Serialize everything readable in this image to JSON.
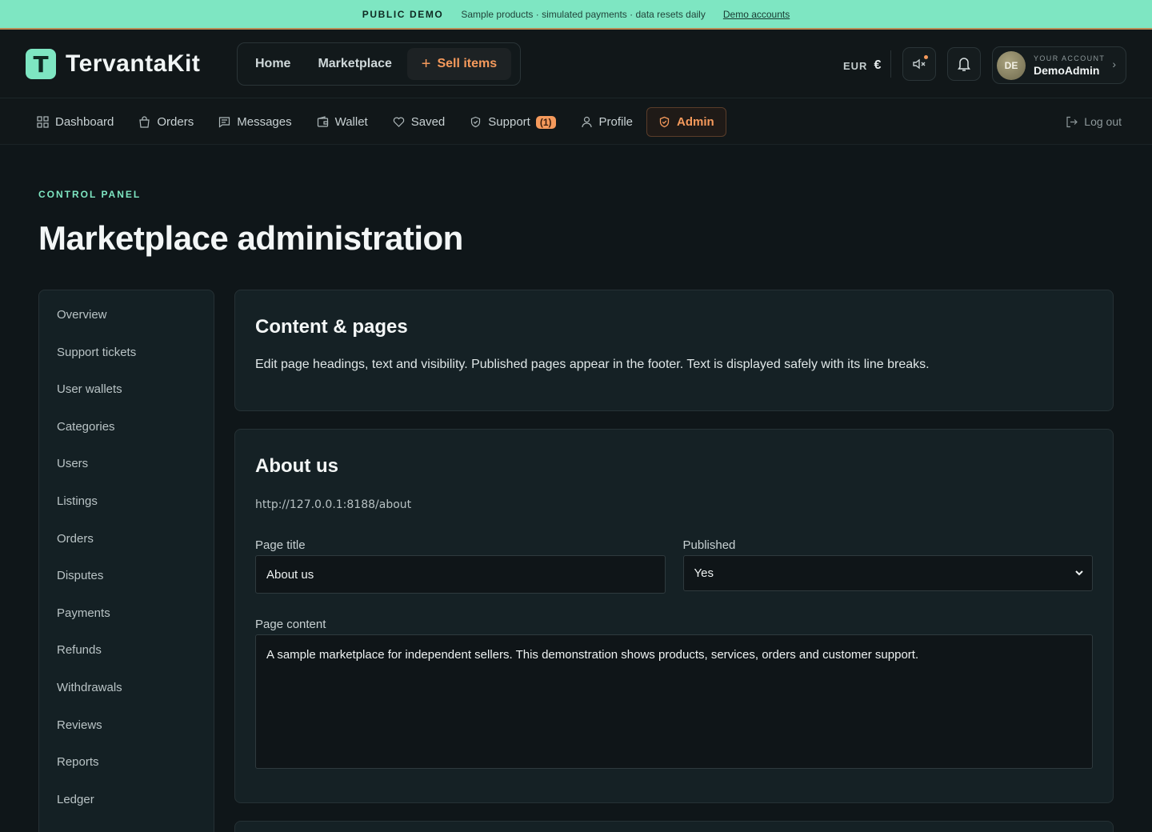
{
  "banner": {
    "tag": "PUBLIC DEMO",
    "text": "Sample products · simulated payments · data resets daily",
    "link": "Demo accounts"
  },
  "header": {
    "logo_letter": "T",
    "brand": "TervantaKit",
    "nav": {
      "home": "Home",
      "marketplace": "Marketplace",
      "sell": "Sell items"
    },
    "currency_code": "EUR",
    "currency_symbol": "€",
    "account": {
      "initials": "DE",
      "label": "YOUR ACCOUNT",
      "name": "DemoAdmin"
    }
  },
  "subnav": {
    "items": [
      "Dashboard",
      "Orders",
      "Messages",
      "Wallet",
      "Saved",
      "Support",
      "Profile",
      "Admin"
    ],
    "support_badge": "(1)",
    "active": "Admin",
    "logout": "Log out"
  },
  "page": {
    "eyebrow": "CONTROL PANEL",
    "title": "Marketplace administration"
  },
  "sidebar": {
    "items": [
      "Overview",
      "Support tickets",
      "User wallets",
      "Categories",
      "Users",
      "Listings",
      "Orders",
      "Disputes",
      "Payments",
      "Refunds",
      "Withdrawals",
      "Reviews",
      "Reports",
      "Ledger"
    ]
  },
  "content_card": {
    "title": "Content & pages",
    "description": "Edit page headings, text and visibility. Published pages appear in the footer. Text is displayed safely with its line breaks."
  },
  "about_card": {
    "title": "About us",
    "url": "http://127.0.0.1:8188/about",
    "page_title_label": "Page title",
    "page_title_value": "About us",
    "published_label": "Published",
    "published_value": "Yes",
    "content_label": "Page content",
    "content_value": "A sample marketplace for independent sellers. This demonstration shows products, services, orders and customer support."
  },
  "colors": {
    "accent_mint": "#7ee6c2",
    "accent_orange": "#f59a5c",
    "background": "#0f1619"
  }
}
